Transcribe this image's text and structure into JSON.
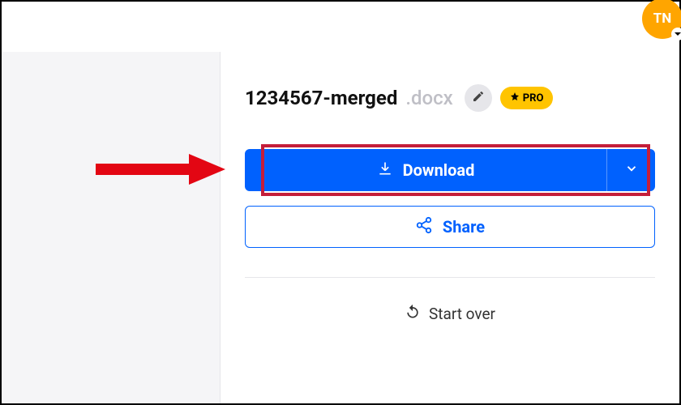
{
  "avatar": {
    "initials": "TN"
  },
  "file": {
    "name": "1234567-merged",
    "ext": ".docx"
  },
  "badge": {
    "pro": "PRO"
  },
  "buttons": {
    "download": "Download",
    "share": "Share",
    "start_over": "Start over"
  }
}
